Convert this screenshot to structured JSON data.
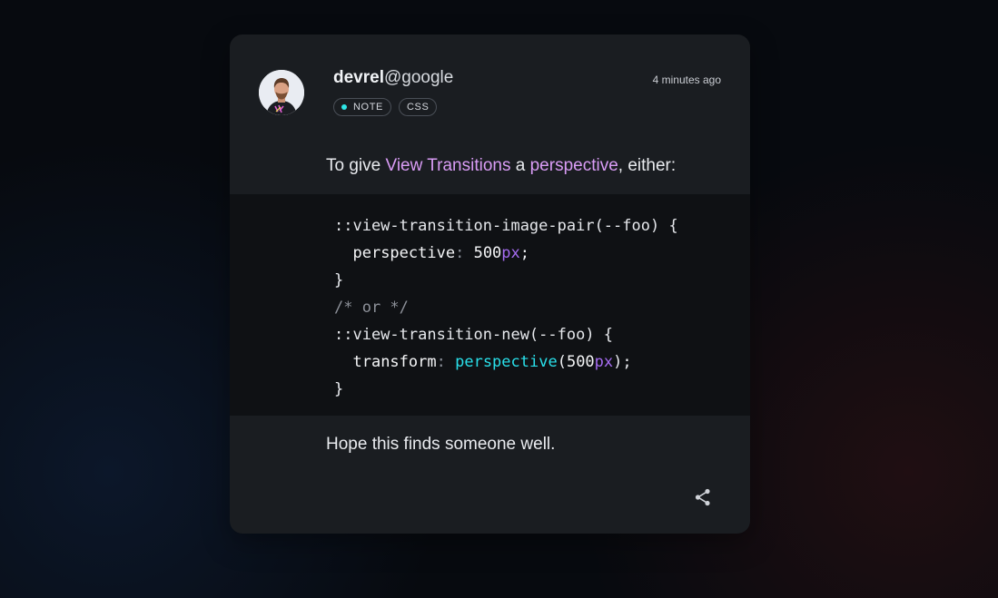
{
  "post": {
    "author_user": "devrel",
    "author_domain": "@google",
    "timestamp": "4 minutes ago",
    "tags": [
      {
        "label": "NOTE",
        "dot_color": "#2ee6e6"
      },
      {
        "label": "CSS"
      }
    ],
    "intro": {
      "before": "To give ",
      "link1": "View Transitions",
      "middle": " a ",
      "link2": "perspective",
      "after": ", either:"
    },
    "code": {
      "l1_sel": "::view-transition-image-pair(--foo) {",
      "l2_prop": "perspective",
      "l2_colon": ":",
      "l2_num": "500",
      "l2_unit": "px",
      "l2_end": ";",
      "l3": "}",
      "l4_comment": "/* or */",
      "l5_sel": "::view-transition-new(--foo) {",
      "l6_prop": "transform",
      "l6_colon": ":",
      "l6_fn": "perspective",
      "l6_open": "(",
      "l6_num": "500",
      "l6_unit": "px",
      "l6_end": ");",
      "l7": "}"
    },
    "outro": "Hope this finds someone well.",
    "share_icon": "share-icon",
    "colors": {
      "accent_link": "#d99cf5",
      "code_function": "#29e0ea",
      "code_unit": "#a56cf0",
      "card_bg": "#1a1d21",
      "code_bg": "#0f1114"
    }
  }
}
